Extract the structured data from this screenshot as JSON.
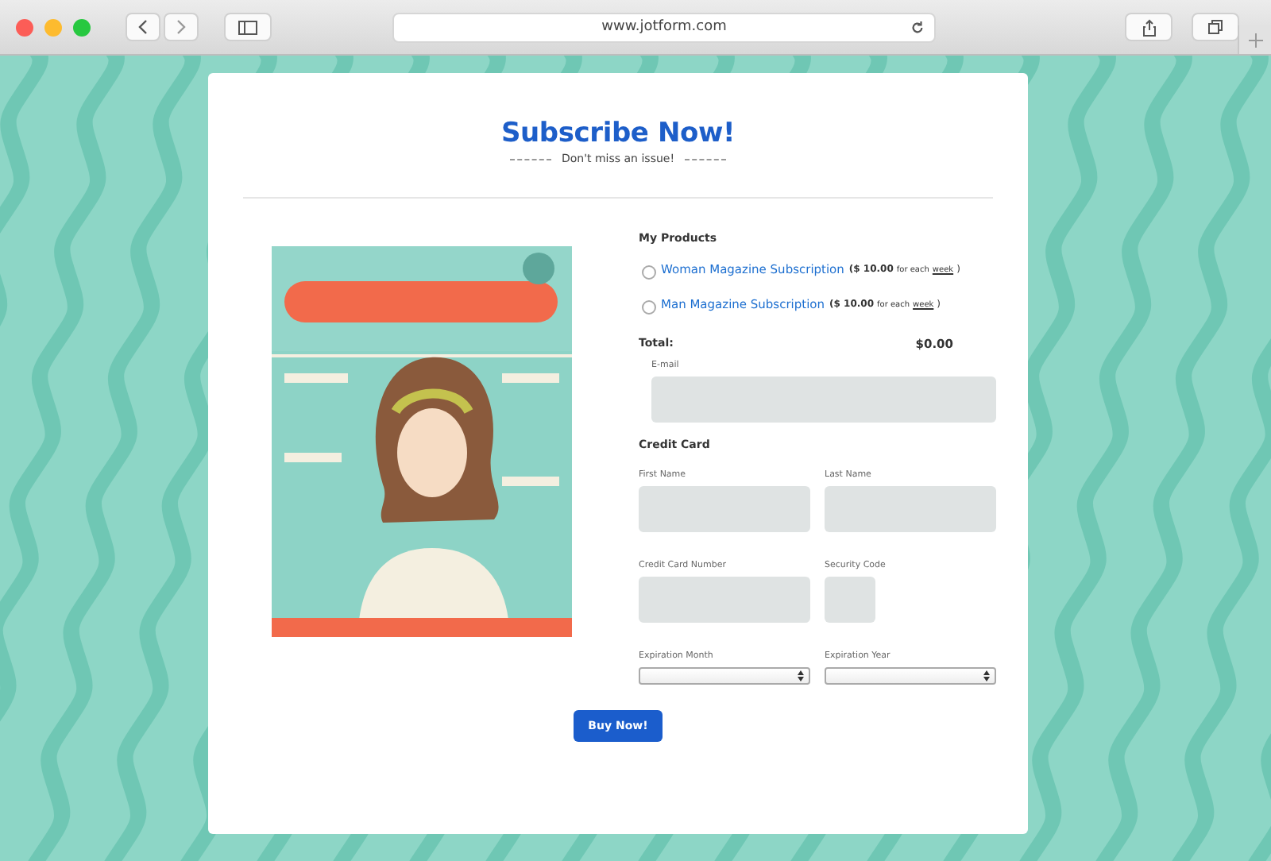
{
  "browser": {
    "url": "www.jotform.com"
  },
  "form": {
    "title": "Subscribe Now!",
    "subtitle": "Don't miss an issue!",
    "products_label": "My Products",
    "products": [
      {
        "name": "Woman Magazine Subscription",
        "price": "($ 10.00",
        "per": "for each",
        "period": "week",
        "suffix": ")",
        "selected": false
      },
      {
        "name": "Man Magazine Subscription",
        "price": "($ 10.00",
        "per": "for each",
        "period": "week",
        "suffix": ")",
        "selected": false
      }
    ],
    "total_label": "Total:",
    "total_value": "$0.00",
    "email": {
      "label": "E-mail"
    },
    "credit_card_label": "Credit Card",
    "first_name": {
      "label": "First Name"
    },
    "last_name": {
      "label": "Last Name"
    },
    "card_number": {
      "label": "Credit Card Number"
    },
    "security_code": {
      "label": "Security Code"
    },
    "expiration_month": {
      "label": "Expiration Month"
    },
    "expiration_year": {
      "label": "Expiration Year"
    },
    "submit": "Buy Now!"
  }
}
